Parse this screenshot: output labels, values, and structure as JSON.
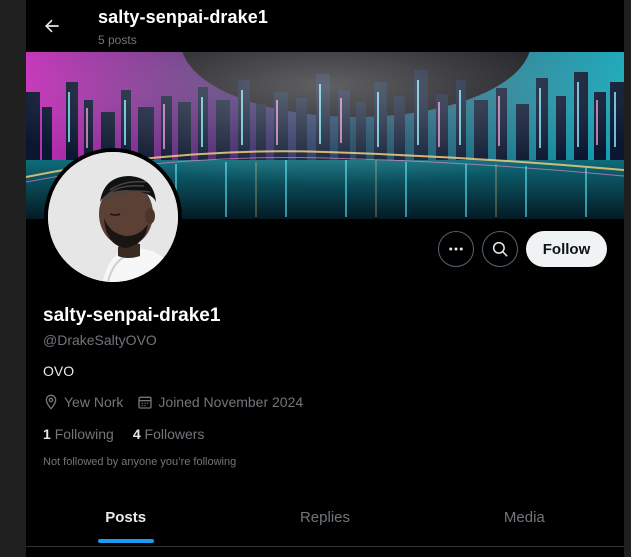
{
  "header": {
    "back_icon": "arrow-left-icon",
    "title": "salty-senpai-drake1",
    "post_count": "5 posts"
  },
  "banner": {
    "description_icon": "cyberpunk-city-banner"
  },
  "actions": {
    "more_icon": "more-horizontal-icon",
    "search_icon": "search-icon",
    "follow_label": "Follow"
  },
  "profile": {
    "name": "salty-senpai-drake1",
    "handle": "@DrakeSaltyOVO",
    "bio": "OVO",
    "location": "Yew Nork",
    "joined": "Joined November 2024",
    "following_count": "1",
    "following_label": "Following",
    "followers_count": "4",
    "followers_label": "Followers",
    "not_followed_note": "Not followed by anyone you’re following"
  },
  "tabs": [
    {
      "label": "Posts",
      "active": true
    },
    {
      "label": "Replies",
      "active": false
    },
    {
      "label": "Media",
      "active": false
    }
  ],
  "colors": {
    "accent": "#1d9bf0",
    "background": "#000000",
    "muted_text": "#71767b",
    "follow_button_bg": "#eff3f4"
  }
}
